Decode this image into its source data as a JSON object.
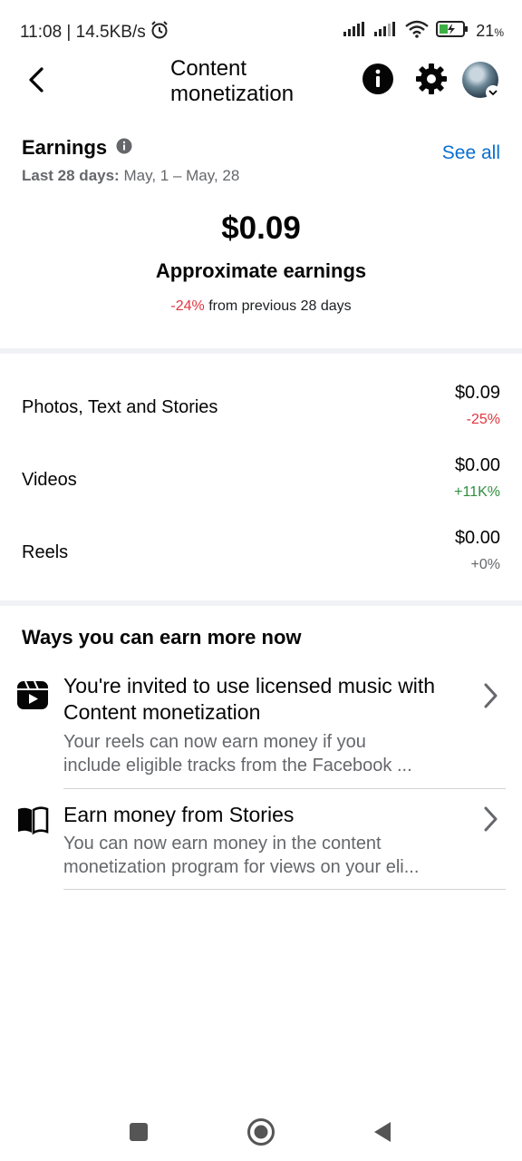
{
  "status_bar": {
    "time_speed": "11:08 | 14.5KB/s",
    "battery": "21",
    "battery_unit": "%"
  },
  "header": {
    "title": "Content monetization"
  },
  "earnings": {
    "title": "Earnings",
    "see_all": "See all",
    "period_label": "Last 28 days:",
    "period_range": "May, 1 – May, 28",
    "amount": "$0.09",
    "amount_label": "Approximate earnings",
    "change_pct": "-24%",
    "change_text": "from previous 28 days"
  },
  "breakdown": [
    {
      "label": "Photos, Text and Stories",
      "value": "$0.09",
      "change": "-25%"
    },
    {
      "label": "Videos",
      "value": "$0.00",
      "change": "+11K%"
    },
    {
      "label": "Reels",
      "value": "$0.00",
      "change": "+0%"
    }
  ],
  "ways": {
    "title": "Ways you can earn more now",
    "items": [
      {
        "icon": "reels-icon",
        "title": "You're invited to use licensed music with Content monetization",
        "description": "Your reels can now earn money if you include eligible tracks from the Facebook ..."
      },
      {
        "icon": "book-icon",
        "title": "Earn money from Stories",
        "description": "You can now earn money in the content monetization program for views on your eli..."
      }
    ]
  },
  "colors": {
    "link": "#0a6fd0",
    "negative": "#e0363f",
    "positive": "#2f8f3f",
    "neutral": "#65676b"
  }
}
